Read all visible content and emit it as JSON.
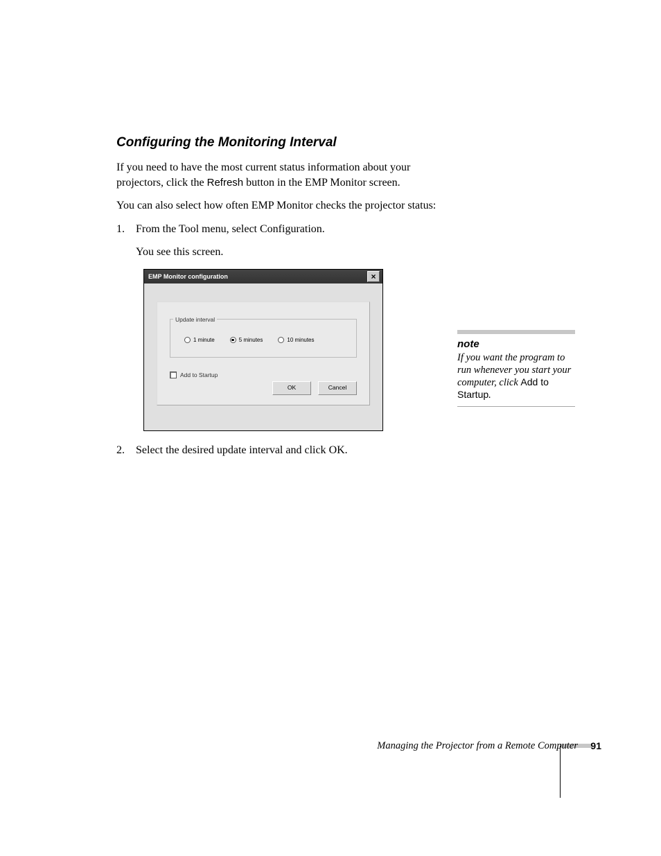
{
  "section_title": "Configuring the Monitoring Interval",
  "intro_para_before": "If you need to have the most current status information about your projectors, click the ",
  "intro_refresh": "Refresh",
  "intro_para_after": " button in the EMP Monitor screen.",
  "para2": "You can also select how often EMP Monitor checks the projector status:",
  "step1_num": "1.",
  "step1_before": "From the Tool menu, select ",
  "step1_config": "Configuration",
  "step1_after": ".",
  "step1_sub": "You see this screen.",
  "step2_num": "2.",
  "step2_before": "Select the desired update interval and click ",
  "step2_ok": "OK",
  "step2_after": ".",
  "dialog": {
    "title": "EMP Monitor configuration",
    "close": "×",
    "group_label": "Update interval",
    "opt1": "1 minute",
    "opt2": "5 minutes",
    "opt3": "10 minutes",
    "selected_index": 1,
    "checkbox_label": "Add to Startup",
    "btn_ok": "OK",
    "btn_cancel": "Cancel"
  },
  "note": {
    "heading": "note",
    "body_before": "If you want the program to run whenever you start your computer, click ",
    "body_sans": "Add to Startup",
    "body_after": "."
  },
  "footer": {
    "text": "Managing the Projector from a Remote Computer",
    "page": "91"
  }
}
